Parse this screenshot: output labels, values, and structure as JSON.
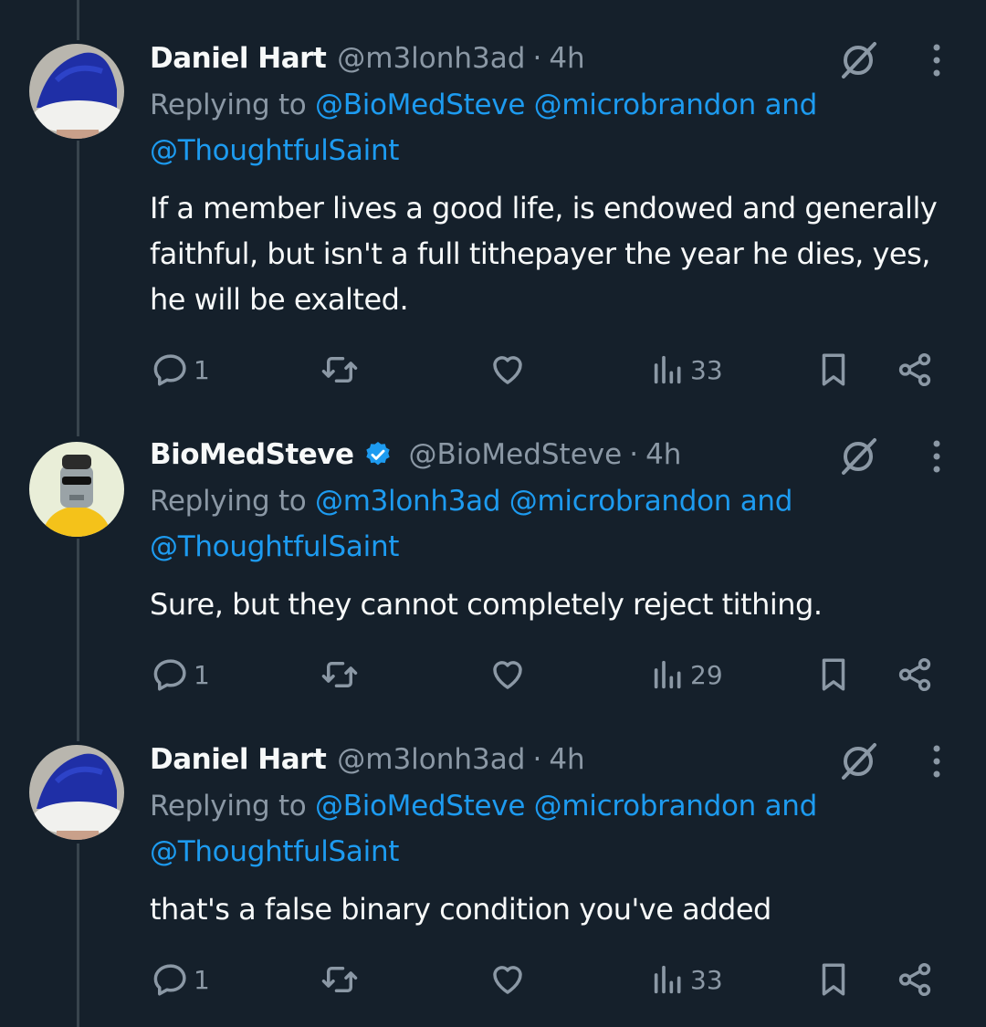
{
  "tweets": [
    {
      "name": "Daniel Hart",
      "handle": "@m3lonh3ad",
      "separator": "·",
      "time": "4h",
      "verified": false,
      "replying_prefix": "Replying to",
      "mentions": [
        "@BioMedSteve",
        "@microbrandon"
      ],
      "mention_and": "and",
      "mention_last": "@ThoughtfulSaint",
      "text": "If a member lives a good life, is endowed and generally faithful, but isn't a full tithepayer the year he dies, yes, he will be exalted.",
      "reply_count": "1",
      "retweet_count": "",
      "like_count": "",
      "view_count": "33"
    },
    {
      "name": "BioMedSteve",
      "handle": "@BioMedSteve",
      "separator": "·",
      "time": "4h",
      "verified": true,
      "replying_prefix": "Replying to",
      "mentions": [
        "@m3lonh3ad",
        "@microbrandon"
      ],
      "mention_and": "and",
      "mention_last": "@ThoughtfulSaint",
      "text": "Sure, but they cannot completely reject tithing.",
      "reply_count": "1",
      "retweet_count": "",
      "like_count": "",
      "view_count": "29"
    },
    {
      "name": "Daniel Hart",
      "handle": "@m3lonh3ad",
      "separator": "·",
      "time": "4h",
      "verified": false,
      "replying_prefix": "Replying to",
      "mentions": [
        "@BioMedSteve",
        "@microbrandon"
      ],
      "mention_and": "and",
      "mention_last": "@ThoughtfulSaint",
      "text": "that's a false binary condition you've added",
      "reply_count": "1",
      "retweet_count": "",
      "like_count": "",
      "view_count": "33"
    }
  ],
  "colors": {
    "background": "#15202b",
    "text": "#f7f9f9",
    "secondary": "#8b98a5",
    "link": "#1d9bf0",
    "thread_line": "#38444d"
  },
  "icons": {
    "reply": "reply-icon",
    "retweet": "retweet-icon",
    "like": "heart-icon",
    "views": "views-icon",
    "bookmark": "bookmark-icon",
    "share": "share-icon",
    "grok": "grok-icon",
    "more": "more-icon",
    "verified": "verified-badge-icon"
  }
}
